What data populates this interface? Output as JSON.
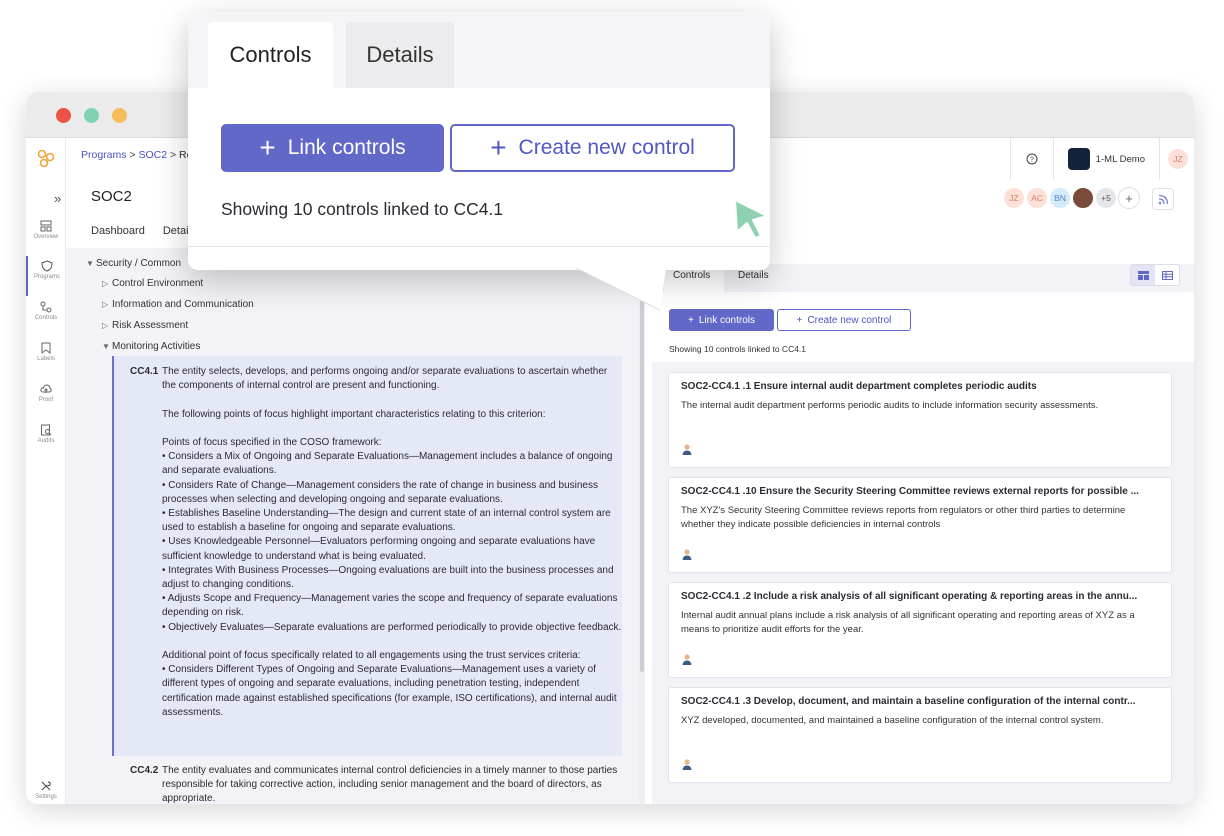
{
  "app": {
    "breadcrumb": {
      "programs": "Programs",
      "sep1": " > ",
      "soc2": "SOC2",
      "sep2": " > ",
      "current": "Req"
    },
    "org_name": "1-ML Demo",
    "user_initials": "JZ",
    "page_title": "SOC2",
    "subnav": {
      "dashboard": "Dashboard",
      "details": "Detai"
    }
  },
  "rail": {
    "overview": "Overview",
    "programs": "Programs",
    "controls": "Controls",
    "labels": "Labels",
    "proof": "Proof",
    "audits": "Audits",
    "settings": "Settings"
  },
  "members": {
    "a1": "JZ",
    "a2": "AC",
    "a3": "BN",
    "more": "+5"
  },
  "tree": {
    "root": "Security / Common",
    "control_env": "Control Environment",
    "info_comm": "Information and Communication",
    "risk": "Risk Assessment",
    "monitoring": "Monitoring Activities"
  },
  "criteria": {
    "cc41_code": "CC4.1",
    "cc41_text": "The entity selects, develops, and performs ongoing and/or separate evaluations to ascertain whether the components of internal control are present and functioning.\n\nThe following points of focus highlight important characteristics relating to this criterion:\n\nPoints of focus specified in the COSO framework:\n• Considers a Mix of Ongoing and Separate Evaluations—Management includes a balance of ongoing and separate evaluations.\n• Considers Rate of Change—Management considers the rate of change in business and business processes when selecting and developing ongoing and separate evaluations.\n• Establishes Baseline Understanding—The design and current state of an internal control system are used to establish a baseline for ongoing and separate evaluations.\n• Uses Knowledgeable Personnel—Evaluators performing ongoing and separate evaluations have sufficient knowledge to understand what is being evaluated.\n• Integrates With Business Processes—Ongoing evaluations are built into the business processes and adjust to changing conditions.\n• Adjusts Scope and Frequency—Management varies the scope and frequency of separate evaluations depending on risk.\n• Objectively Evaluates—Separate evaluations are performed periodically to provide objective feedback.\n\nAdditional point of focus specifically related to all engagements using the trust services criteria:\n• Considers Different Types of Ongoing and Separate Evaluations—Management uses a variety of different types of ongoing and separate evaluations, including penetration testing, independent certification made against established specifications (for example, ISO certifications), and internal audit assessments.",
    "cc42_code": "CC4.2",
    "cc42_text": "The entity evaluates and communicates internal control deficiencies in a timely manner to those parties responsible for taking corrective action, including senior management and the board of directors, as appropriate."
  },
  "right_panel": {
    "tab_controls": "Controls",
    "tab_details": "Details",
    "link_label": "Link controls",
    "create_label": "Create new control",
    "showing": "Showing 10 controls linked to CC4.1",
    "cards": [
      {
        "title": "SOC2-CC4.1 .1 Ensure internal audit department completes periodic audits",
        "desc": "The internal audit department performs periodic audits to include information security assessments."
      },
      {
        "title": "SOC2-CC4.1 .10 Ensure the Security Steering Committee reviews external reports for possible ...",
        "desc": "The XYZ's Security Steering Committee reviews reports from regulators or other third parties to determine whether they indicate possible deficiencies in internal controls"
      },
      {
        "title": "SOC2-CC4.1 .2 Include a risk analysis of all significant operating & reporting areas in the annu...",
        "desc": "Internal audit annual plans include a risk analysis of all significant operating and reporting areas of XYZ as a means to prioritize audit efforts for the year."
      },
      {
        "title": "SOC2-CC4.1 .3 Develop, document, and maintain a baseline configuration of the internal contr...",
        "desc": "XYZ developed, documented, and maintained a baseline configuration of the internal control system."
      }
    ]
  },
  "popover": {
    "tab_controls": "Controls",
    "tab_details": "Details",
    "link_label": "Link controls",
    "create_label": "Create new control",
    "showing": "Showing 10 controls linked to CC4.1"
  },
  "colors": {
    "accent": "#6168c7",
    "highlight": "#e5e8f7",
    "panel_bg": "#f2f2f7",
    "cursor": "#8ed1b2"
  }
}
